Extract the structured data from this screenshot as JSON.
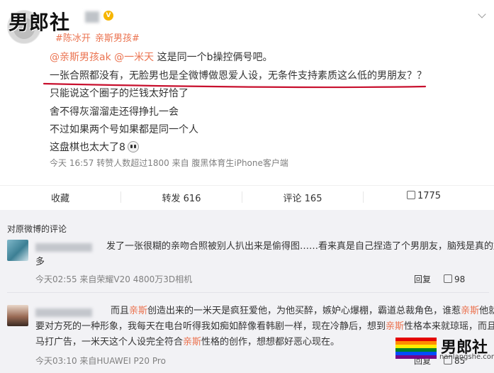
{
  "post": {
    "author_blurred": true,
    "watermark": "男郎社",
    "topics": [
      "#陈冰开",
      "亲斯男孩#"
    ],
    "lines": [
      {
        "mention1": "@亲斯男孩ak",
        "mention2": "@一米天",
        "text": " 这是同一个b操控俩号吧。"
      },
      {
        "text": "一张合照都没有，无脸男也是全微博做恩爱人设，无条件支持素质这么低的男朋友？？"
      },
      {
        "text": "只能说这个圈子的烂钱太好恰了"
      },
      {
        "text": "舍不得灰溜溜走还得挣扎一会"
      },
      {
        "text": "不过如果两个号如果都是同一个人"
      },
      {
        "text": "这盘棋也太大了8"
      }
    ],
    "meta": "今天 16:57 转赞人数超过1800  来自 腹黑体育生iPhone客户端"
  },
  "actions": {
    "favorite": "收藏",
    "repost": "转发 616",
    "comment": "评论 165",
    "like": "1775"
  },
  "comments": {
    "title": "对原微博的评论",
    "items": [
      {
        "text_highlight": "发了一张很糊的亲吻合照被别人扒出来是偷得图",
        "text_rest": "……看来真是自己捏造了个男朋友，脑残是真的好",
        "text_line2": "多",
        "meta": "今天02:55 来自荣耀V20 4800万3D相机",
        "reply": "回复",
        "likes": "98"
      },
      {
        "l1_a": "而且",
        "l1_b": "亲斯",
        "l1_c": "创造出来的",
        "l1_d": "一米天是疯狂爱他，为他买醉，嫉妒心爆棚，霸道总裁角色",
        "l1_e": "，谁惹",
        "l1_f": "亲斯",
        "l1_g": "他就",
        "l2": "要对方死的一种形象，我每天在电台听得我如痴如醉像看韩剧一样，现在冷静后，想到",
        "l2_b": "亲斯",
        "l2_c": "性格本来就琼瑶，而且立",
        "l3_a": "马打广告，一米天这个人设完全符合",
        "l3_b": "亲斯",
        "l3_c": "性格的创作，想想都好恶心现在。",
        "meta": "今天03:10 来自HUAWEI P20 Pro",
        "reply": "回复",
        "likes": "85"
      }
    ]
  },
  "footer_watermark": {
    "name": "男郎社",
    "url": "nanlangshe.com"
  },
  "colors": {
    "mention": "#eb7350",
    "underline": "#c8102e",
    "comments_bg": "#f2f2f5"
  }
}
